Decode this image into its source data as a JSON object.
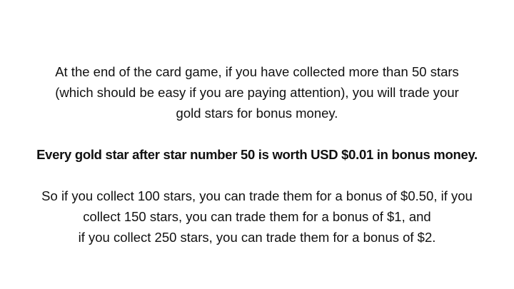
{
  "slide": {
    "intro_lines": [
      "At the end of the card game, if you have collected more than 50 stars",
      "(which should be easy if you are paying attention), you will trade your",
      "gold stars for bonus money."
    ],
    "rule": "Every gold star after star number 50 is worth USD $0.01 in bonus money.",
    "example_lines": [
      "So if you collect 100 stars, you can trade them for a bonus of $0.50, if you",
      "collect 150 stars, you can trade them for a bonus of $1, and",
      "if you collect 250 stars, you can trade them for a bonus of $2."
    ]
  }
}
